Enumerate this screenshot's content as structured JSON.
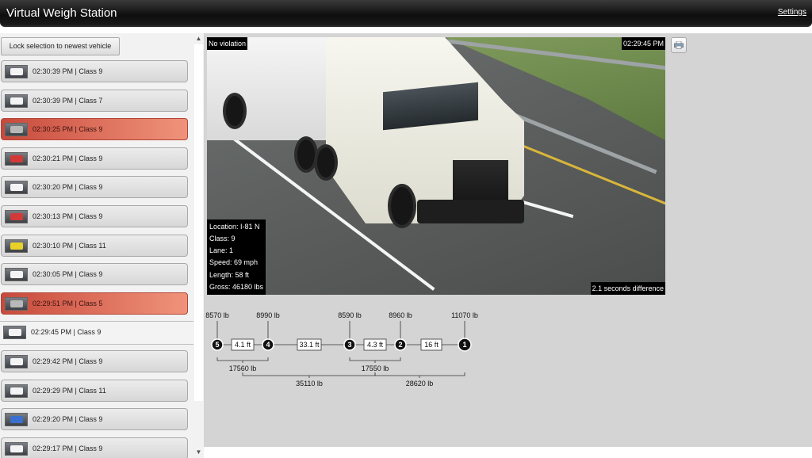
{
  "header": {
    "title": "Virtual Weigh Station",
    "settings_label": "Settings"
  },
  "sidebar": {
    "lock_button_label": "Lock selection to newest vehicle",
    "items": [
      {
        "label": "02:30:39 PM | Class 9",
        "status": "normal",
        "thumb_color": "white"
      },
      {
        "label": "02:30:39 PM | Class 7",
        "status": "normal",
        "thumb_color": "white"
      },
      {
        "label": "02:30:25 PM | Class 9",
        "status": "violation",
        "thumb_color": "gray"
      },
      {
        "label": "02:30:21 PM | Class 9",
        "status": "normal",
        "thumb_color": "red"
      },
      {
        "label": "02:30:20 PM | Class 9",
        "status": "normal",
        "thumb_color": "white"
      },
      {
        "label": "02:30:13 PM | Class 9",
        "status": "normal",
        "thumb_color": "red"
      },
      {
        "label": "02:30:10 PM | Class 11",
        "status": "normal",
        "thumb_color": "yellow"
      },
      {
        "label": "02:30:05 PM | Class 9",
        "status": "normal",
        "thumb_color": "white"
      },
      {
        "label": "02:29:51 PM | Class 5",
        "status": "violation",
        "thumb_color": "gray"
      },
      {
        "label": "02:29:45 PM | Class 9",
        "status": "selected",
        "thumb_color": "white"
      },
      {
        "label": "02:29:42 PM | Class 9",
        "status": "normal",
        "thumb_color": "white"
      },
      {
        "label": "02:29:29 PM | Class 11",
        "status": "normal",
        "thumb_color": "white"
      },
      {
        "label": "02:29:20 PM | Class 9",
        "status": "normal",
        "thumb_color": "blue"
      },
      {
        "label": "02:29:17 PM | Class 9",
        "status": "normal",
        "thumb_color": "white"
      }
    ]
  },
  "camera": {
    "violation_status": "No violation",
    "timestamp": "02:29:45 PM",
    "time_difference": "2.1 seconds difference",
    "details": [
      "Location: I-81 N",
      "Class: 9",
      "Lane: 1",
      "Speed: 69 mph",
      "Length: 58 ft",
      "Gross: 46180 lbs"
    ]
  },
  "axles": {
    "weights": [
      "8570 lb",
      "8990 lb",
      "8590 lb",
      "8960 lb",
      "11070 lb"
    ],
    "numbers": [
      "5",
      "4",
      "3",
      "2",
      "1"
    ],
    "spacings": [
      "4.1 ft",
      "33.1 ft",
      "4.3 ft",
      "16 ft"
    ],
    "group_weights": [
      "17560 lb",
      "17550 lb",
      "35110 lb",
      "28620 lb"
    ]
  },
  "icons": {
    "print": "printer-icon",
    "scroll_up": "chevron-up-icon",
    "scroll_down": "chevron-down-icon"
  }
}
